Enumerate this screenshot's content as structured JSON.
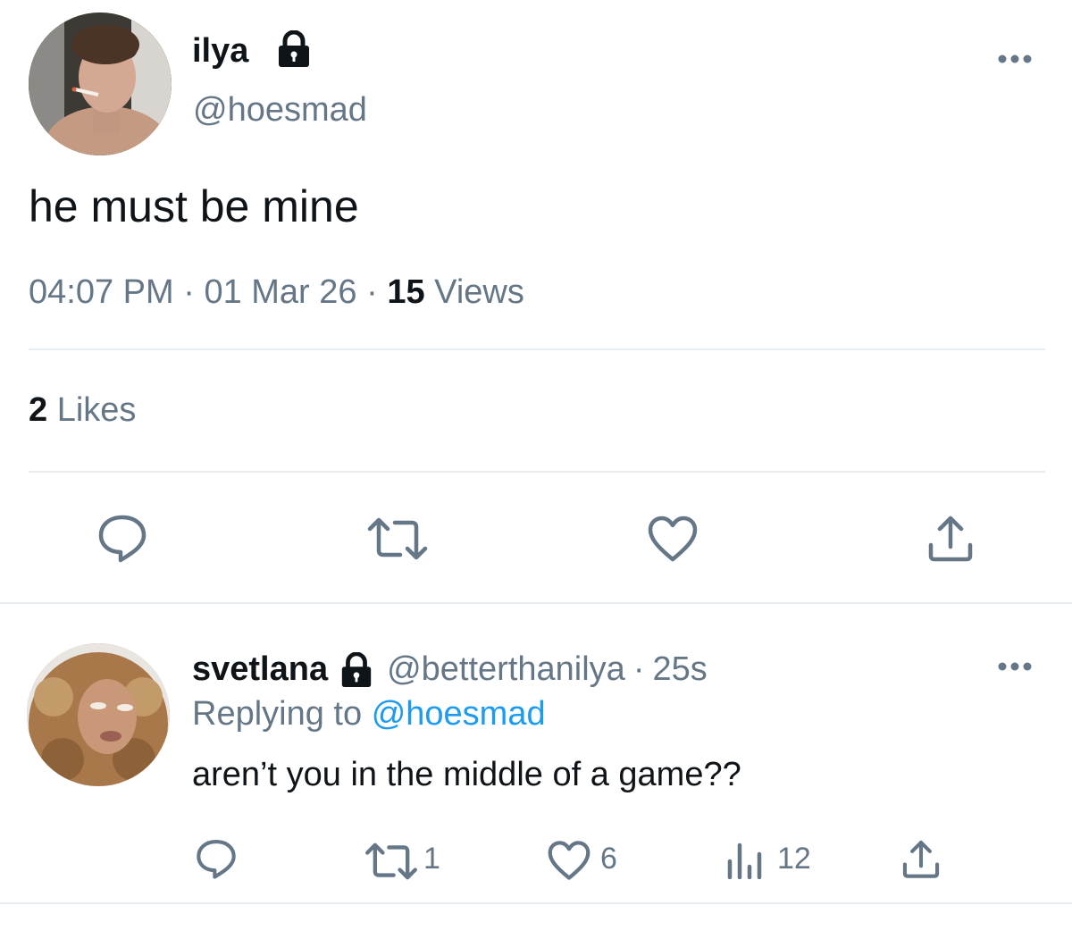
{
  "main_tweet": {
    "author": {
      "display_name": "ilya",
      "handle": "@hoesmad",
      "avatar_icon": "avatar-photo-man-smoking",
      "locked": true
    },
    "text": "he must be mine",
    "meta": {
      "time": "04:07 PM",
      "separator": "·",
      "date": "01 Mar 26",
      "views_count": "15",
      "views_label": "Views"
    },
    "likes": {
      "count": "2",
      "label": "Likes"
    },
    "actions": [
      "reply-icon",
      "retweet-icon",
      "like-icon",
      "share-icon"
    ]
  },
  "reply": {
    "author": {
      "display_name": "svetlana",
      "handle": "@betterthanilya",
      "separator": "·",
      "time": "25s",
      "avatar_icon": "avatar-photo-curly-hair",
      "locked": true
    },
    "replying_prefix": "Replying to",
    "replying_to": "@hoesmad",
    "text": "aren’t you in the middle of a game??",
    "actions": {
      "retweets": "1",
      "likes": "6",
      "views": "12"
    }
  },
  "colors": {
    "text": "#0f1419",
    "secondary": "#657786",
    "link": "#1d9bf0",
    "divider": "#e6ecf0"
  }
}
